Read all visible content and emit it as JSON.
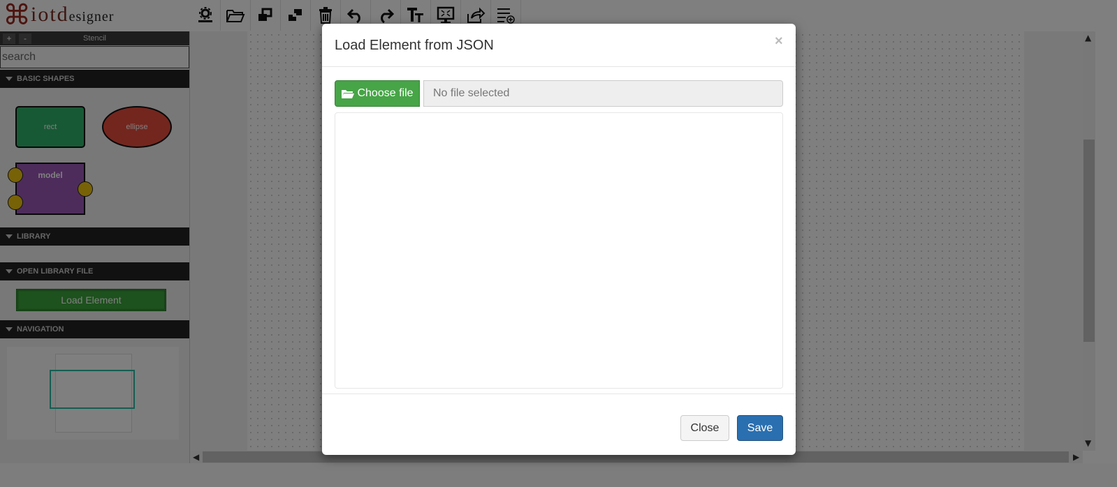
{
  "app": {
    "logo_mark": "⌘",
    "logo_text_main": "iotd",
    "logo_text_sub": "esigner"
  },
  "toolbar": {
    "icons": [
      "gear-export-icon",
      "folder-open-icon",
      "bring-to-front-icon",
      "send-to-back-icon",
      "trash-icon",
      "undo-icon",
      "redo-icon",
      "text-icon",
      "screen-fit-icon",
      "share-icon",
      "list-add-icon"
    ]
  },
  "sidebar": {
    "zoom_in_label": "+",
    "zoom_out_label": "-",
    "stencil_title": "Stencil",
    "search_placeholder": "search",
    "sections": {
      "basic_shapes": "BASIC SHAPES",
      "library": "LIBRARY",
      "open_library_file": "OPEN LIBRARY FILE",
      "navigation": "NAVIGATION"
    },
    "shapes": {
      "rect": "rect",
      "ellipse": "ellipse",
      "model": "model"
    },
    "load_element_label": "Load Element"
  },
  "scrollbars": {
    "up": "▲",
    "down": "▼",
    "left": "◀",
    "right": "▶"
  },
  "modal": {
    "title": "Load Element from JSON",
    "close_x": "×",
    "choose_file_label": "Choose file",
    "file_field_value": "No file selected",
    "close_label": "Close",
    "save_label": "Save"
  },
  "colors": {
    "rect_fill": "#31b26a",
    "ellipse_fill": "#e74c3c",
    "model_fill": "#9b59b6",
    "port_fill": "#f1c40f",
    "success": "#47a447",
    "primary": "#2a6fb0"
  }
}
